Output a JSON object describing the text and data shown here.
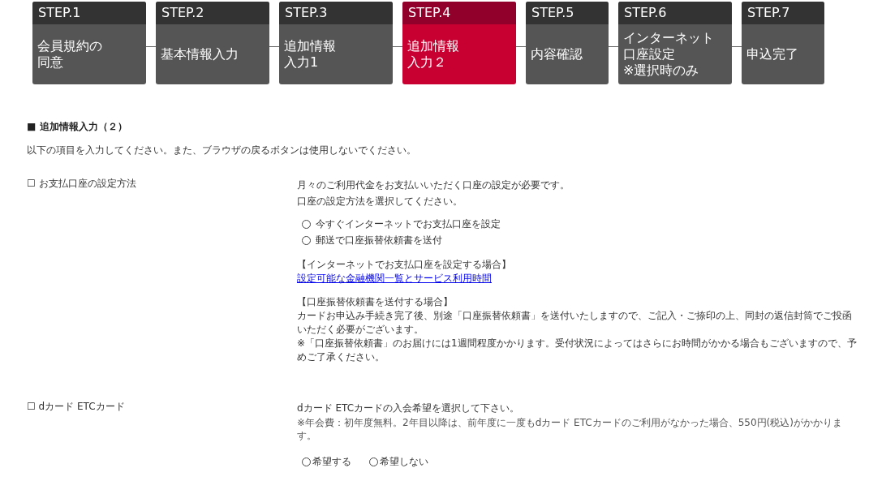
{
  "steps": [
    {
      "number": "STEP.1",
      "lines": [
        "会員規約の",
        "同意"
      ],
      "selected": false
    },
    {
      "number": "STEP.2",
      "lines": [
        "基本情報入力"
      ],
      "selected": false
    },
    {
      "number": "STEP.3",
      "lines": [
        "追加情報",
        "入力1"
      ],
      "selected": false
    },
    {
      "number": "STEP.4",
      "lines": [
        "追加情報",
        "入力２"
      ],
      "selected": true
    },
    {
      "number": "STEP.5",
      "lines": [
        "内容確認"
      ],
      "selected": false
    },
    {
      "number": "STEP.6",
      "lines": [
        "インターネット",
        "口座設定",
        "※選択時のみ"
      ],
      "selected": false
    },
    {
      "number": "STEP.7",
      "lines": [
        "申込完了"
      ],
      "selected": false
    }
  ],
  "heading": "■ 追加情報入力（２）",
  "intro": "以下の項目を入力してください。また、ブラウザの戻るボタンは使用しないでください。",
  "sections": [
    {
      "label": "☐ お支払口座の設定方法",
      "description": [
        "月々のご利用代金をお支払いいただく口座の設定が必要です。",
        "口座の設定方法を選択してください。"
      ],
      "kind": "stacked",
      "options": [
        {
          "label": "今すぐインターネットでお支払口座を設定",
          "selected": false
        },
        {
          "label": "郵送で口座振替依頼書を送付",
          "selected": false
        }
      ],
      "info_blocks": [
        {
          "title": "【インターネットでお支払口座を設定する場合】",
          "items": [
            {
              "kind": "link",
              "text": "設定可能な金融機関一覧とサービス利用時間"
            }
          ]
        },
        {
          "title": "【口座振替依頼書を送付する場合】",
          "items": [
            {
              "kind": "text",
              "text": "カードお申込み手続き完了後、別途「口座振替依頼書」を送付いたしますので、ご記入・ご捺印の上、同封の返信封筒でご投函いただく必要がございます。"
            },
            {
              "kind": "text",
              "text": "※「口座振替依頼書」のお届けには1週間程度かかります。受付状況によってはさらにお時間がかかる場合もございますので、予めご了承ください。"
            }
          ]
        }
      ]
    },
    {
      "label": "☐ dカード ETCカード",
      "description": [
        "dカード ETCカードの入会希望を選択して下さい。"
      ],
      "note": "※年会費：初年度無料。2年目以降は、前年度に一度もdカード ETCカードのご利用がなかった場合、550円(税込)がかかります。",
      "kind": "inline",
      "options": [
        {
          "label": "希望する",
          "selected": false
        },
        {
          "label": "希望しない",
          "selected": false
        }
      ]
    }
  ]
}
